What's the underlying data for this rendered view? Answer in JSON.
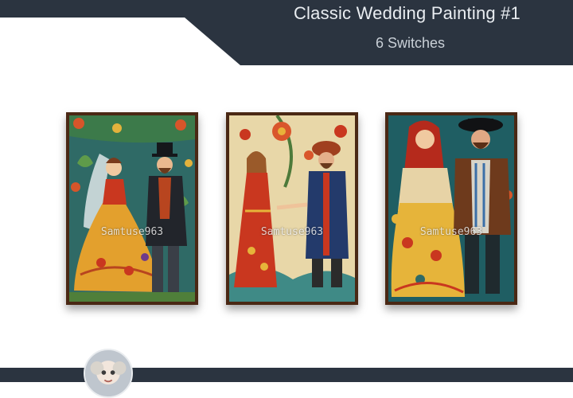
{
  "header": {
    "title": "Classic Wedding Painting #1",
    "subtitle": "6 Switches"
  },
  "paintings": [
    {
      "watermark": "Samtuse963",
      "background": "#2f6a66",
      "dress": "#e3a02d",
      "groom_coat": "#22252b"
    },
    {
      "watermark": "Samtuse963",
      "background": "#e8d7a8",
      "dress": "#c9371f",
      "groom_coat": "#233a6b"
    },
    {
      "watermark": "Samtuse963",
      "background": "#1f5e63",
      "dress": "#e6b43a",
      "groom_coat": "#6e3a1c"
    }
  ],
  "colors": {
    "header_background": "#2b3440",
    "frame": "#4a2814",
    "page_background": "#ffffff"
  },
  "icons": {
    "avatar": "creator-avatar-icon"
  }
}
